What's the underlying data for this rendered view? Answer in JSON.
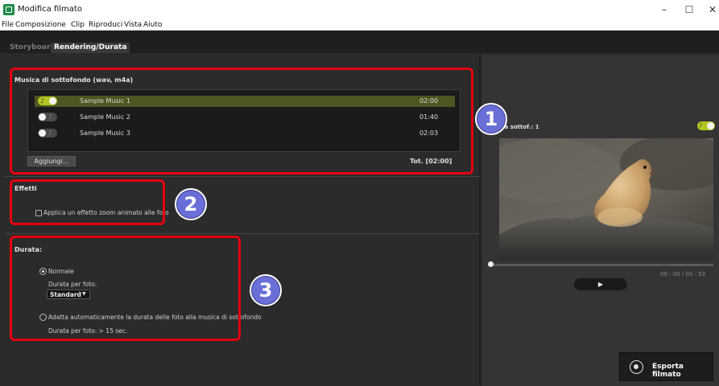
{
  "window": {
    "title": "Modifica filmato",
    "controls": {
      "minimize": "–",
      "maximize": "☐",
      "close": "✕"
    }
  },
  "menu": {
    "items": [
      "File",
      "Composizione",
      "Clip",
      "Riproduci",
      "Vista",
      "Aiuto"
    ]
  },
  "tabs": [
    {
      "label": "Storyboard",
      "active": false
    },
    {
      "label": "Rendering/Durata",
      "active": true
    }
  ],
  "music": {
    "title": "Musica di sottofondo (wav, m4a)",
    "tracks": [
      {
        "name": "Sample Music 1",
        "duration": "02:00",
        "enabled": true,
        "selected": true
      },
      {
        "name": "Sample Music 2",
        "duration": "01:40",
        "enabled": false,
        "selected": false
      },
      {
        "name": "Sample Music 3",
        "duration": "02:03",
        "enabled": false,
        "selected": false
      }
    ],
    "add_label": "Aggiungi...",
    "total": "Tot. [02:00]"
  },
  "effects": {
    "title": "Effetti",
    "zoom_label": "Applica un effetto zoom animato alle foto",
    "zoom_checked": false
  },
  "duration": {
    "title": "Durata:",
    "normal_label": "Normale",
    "normal_selected": true,
    "per_photo_label": "Durata per foto:",
    "per_photo_value": "Standard",
    "auto_label": "Adatta automaticamente la durata delle foto alla musica di sottofondo",
    "auto_selected": false,
    "auto_info": "Durata per foto: > 15 sec."
  },
  "preview": {
    "music_label": "ica sottof.: 1",
    "timecode": "00 : 00  /  00 : 53",
    "play_symbol": "▶",
    "export_label": "Esporta filmato"
  },
  "badges": [
    "1",
    "2",
    "3"
  ],
  "colors": {
    "accent": "#b4c422",
    "highlight": "#e3000f",
    "badge": "#6a6fd8"
  }
}
